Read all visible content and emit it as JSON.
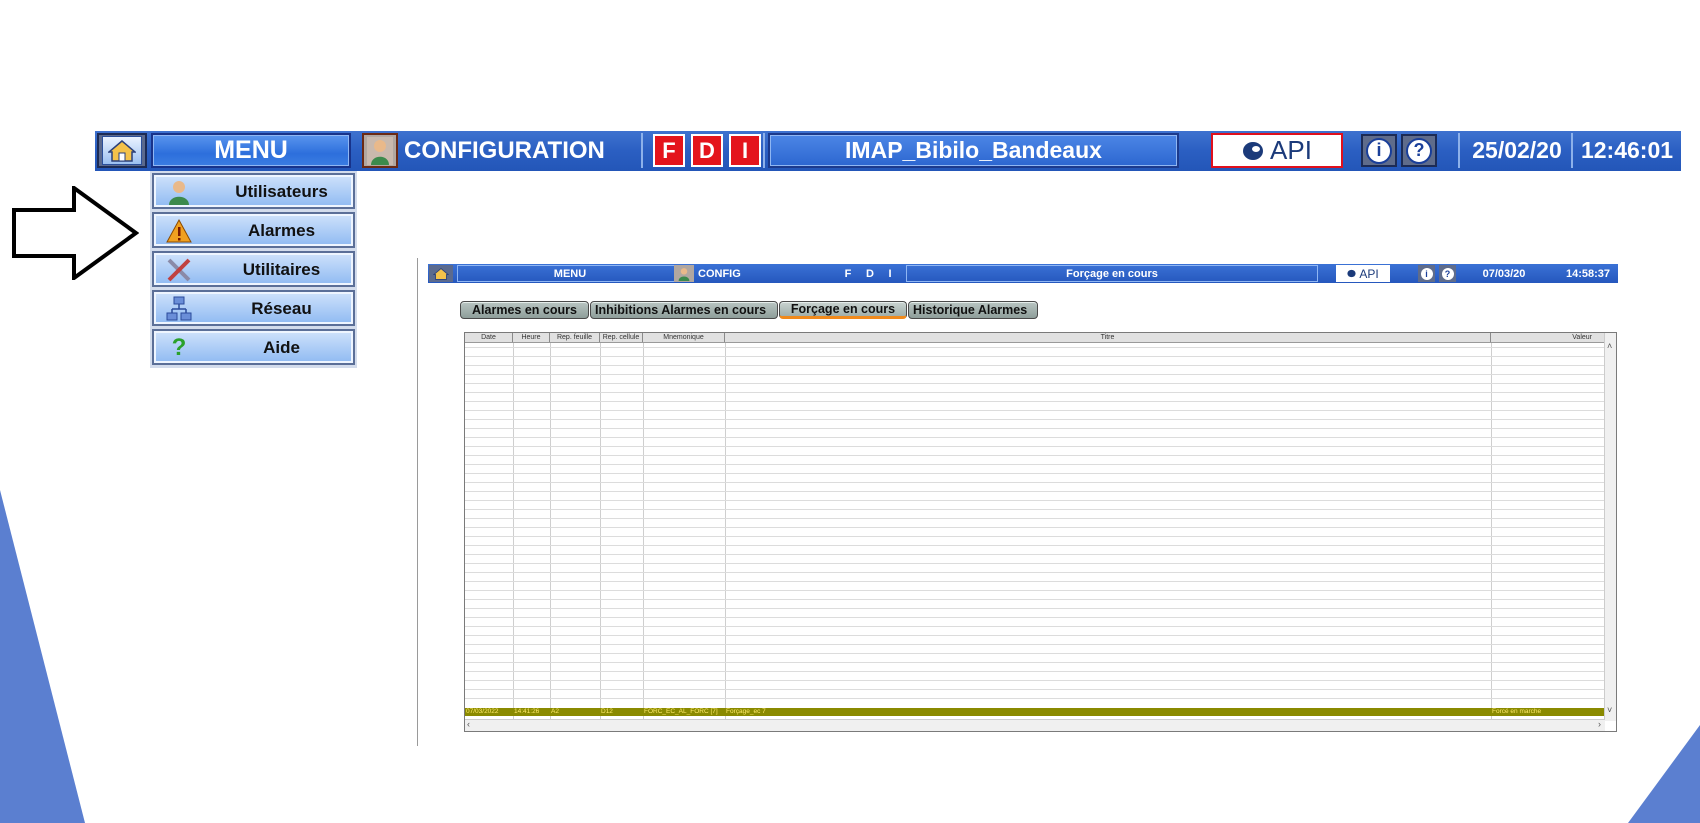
{
  "banner": {
    "menu_label": "MENU",
    "config_label": "CONFIGURATION",
    "fdi": [
      "F",
      "D",
      "I"
    ],
    "title": "IMAP_Bibilo_Bandeaux",
    "api_label": "API",
    "date": "25/02/20",
    "time": "12:46:01"
  },
  "dropdown": {
    "items": [
      {
        "label": "Utilisateurs",
        "icon": "user-icon"
      },
      {
        "label": "Alarmes",
        "icon": "warning-icon"
      },
      {
        "label": "Utilitaires",
        "icon": "tools-icon"
      },
      {
        "label": "Réseau",
        "icon": "network-icon"
      },
      {
        "label": "Aide",
        "icon": "help-icon"
      }
    ]
  },
  "inset": {
    "menu_label": "MENU",
    "config_label": "CONFIG",
    "fdi": [
      "F",
      "D",
      "I"
    ],
    "title": "Forçage en cours",
    "api_label": "API",
    "date": "07/03/20",
    "time": "14:58:37",
    "tabs": [
      "Alarmes en cours",
      "Inhibitions Alarmes en cours",
      "Forçage en cours",
      "Historique Alarmes"
    ],
    "active_tab": "Forçage en cours",
    "columns": [
      "Date",
      "Heure",
      "Rep. feuille",
      "Rep. cellule",
      "Mnemonique",
      "Titre",
      "Valeur"
    ],
    "row": {
      "date": "07/03/2022",
      "heure": "14:41:26",
      "rep_feuille": "A2",
      "rep_cellule": "D12",
      "mnemonique": "FORC_EC_AL_FORC [7]",
      "titre": "Forçage_ec 7",
      "valeur": "Forcé en marche"
    }
  },
  "colors": {
    "banner_blue": "#2b5fc2",
    "fdi_red": "#e4141c",
    "active_tab_underline": "#f08a1c",
    "forced_row": "#8a8a00",
    "deco_blue": "#5b7fd0"
  }
}
